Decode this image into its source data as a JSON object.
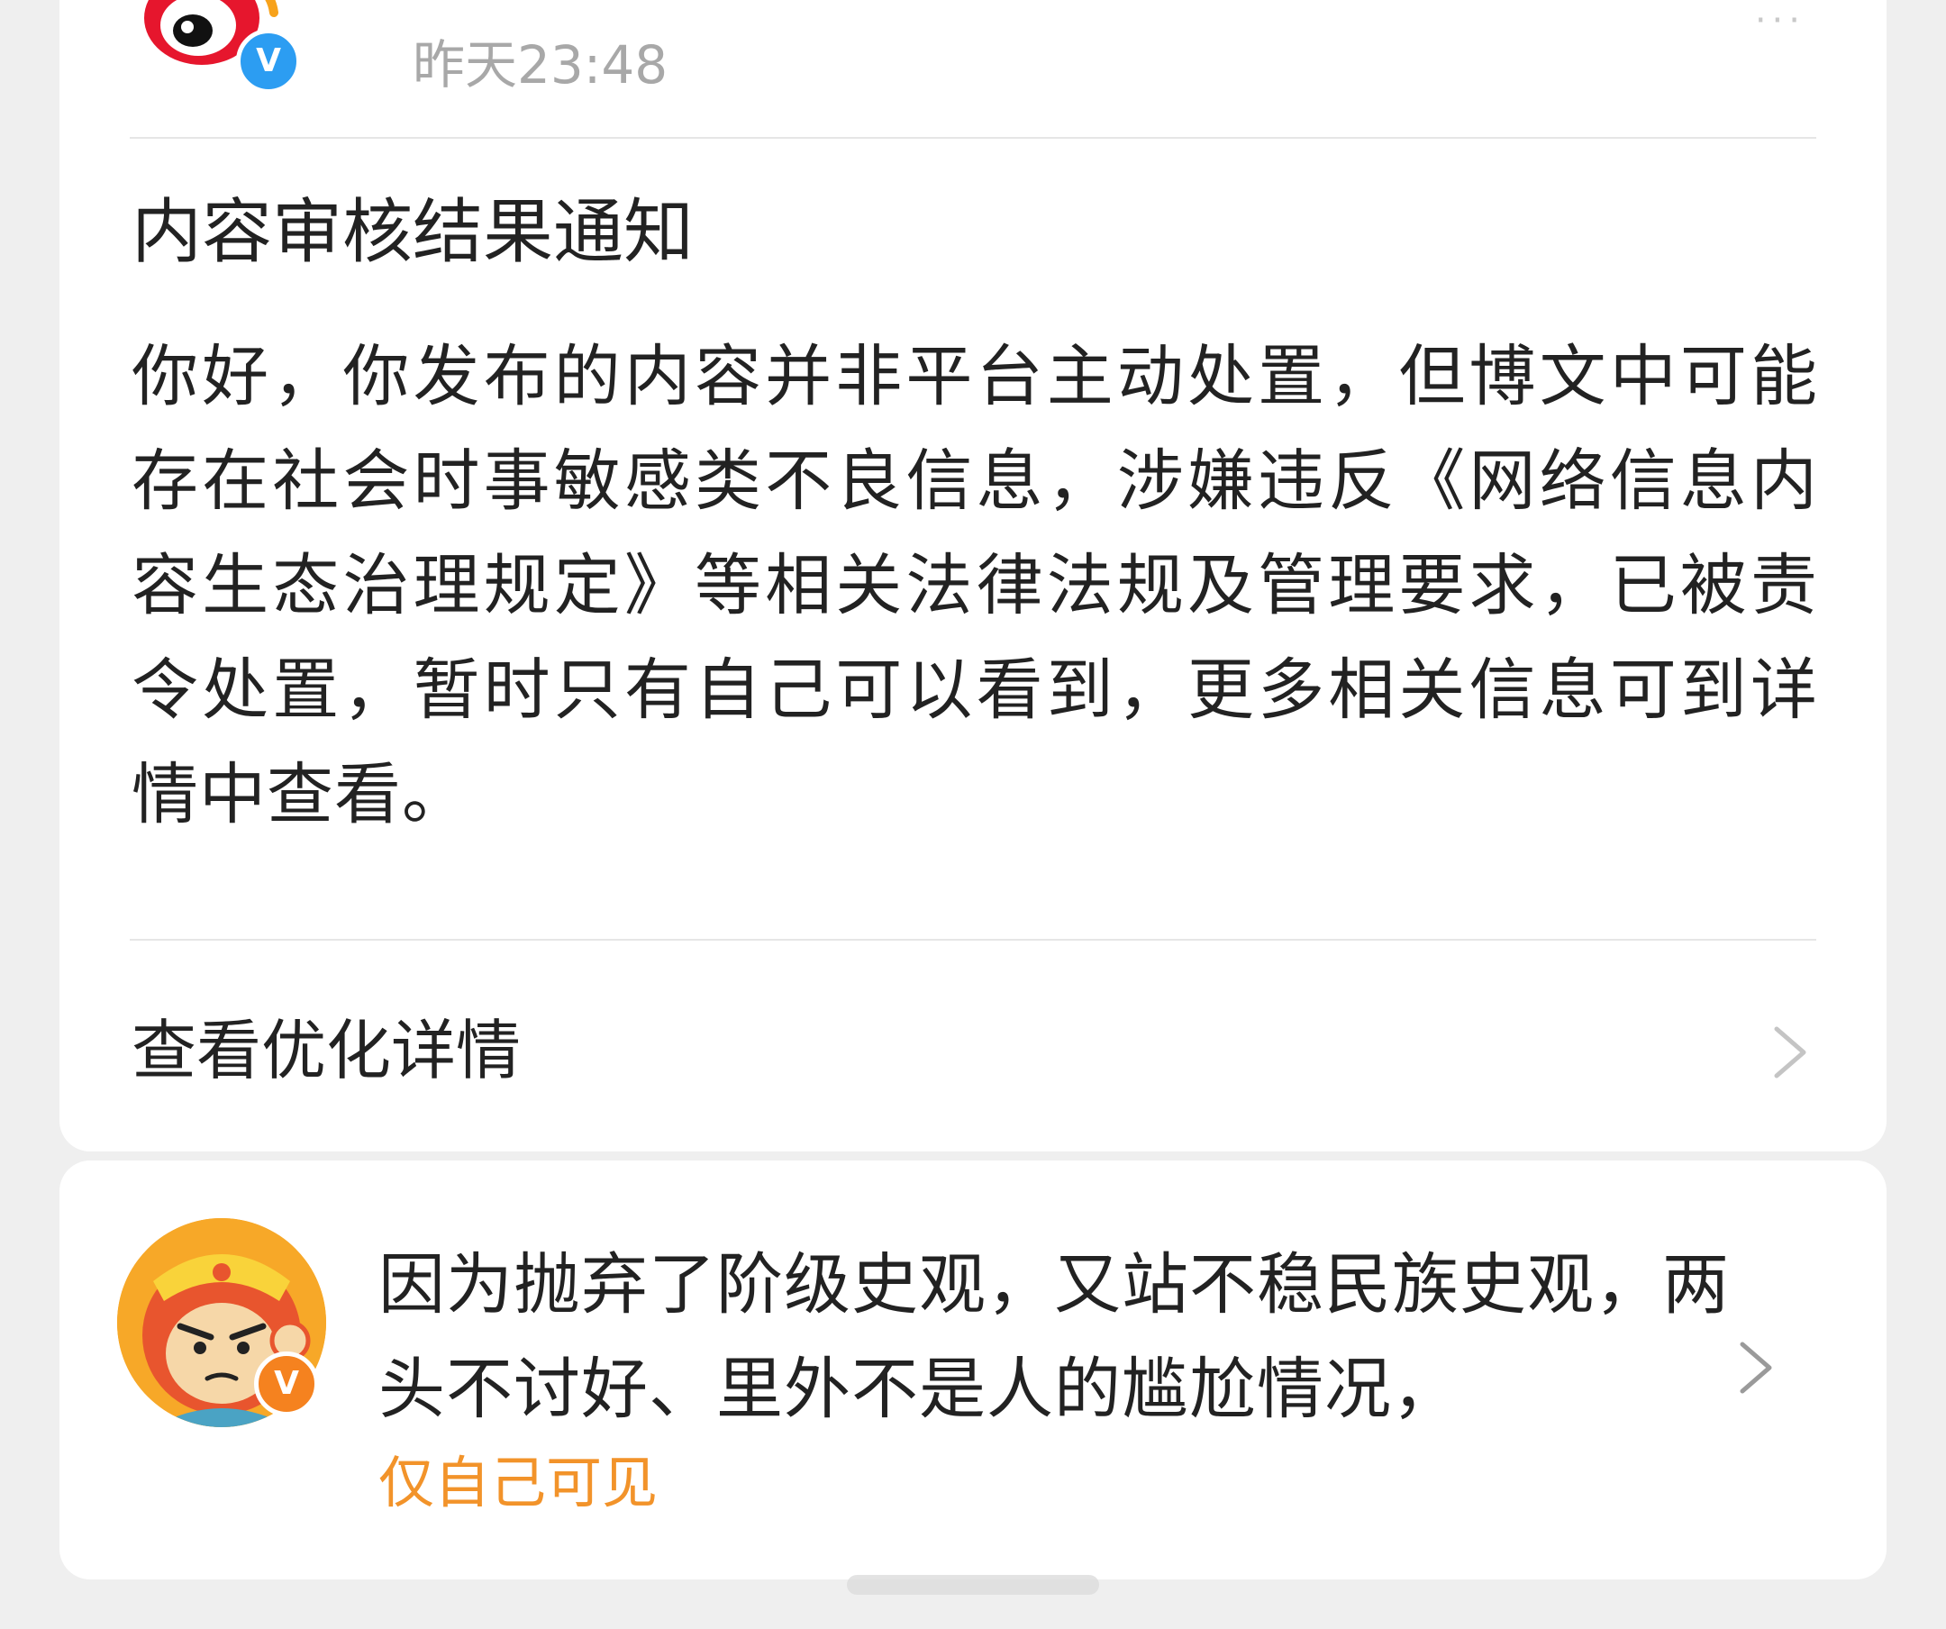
{
  "notice": {
    "sender_verified_badge": "V",
    "timestamp": "昨天23:48",
    "more_label": "···",
    "title": "内容审核结果通知",
    "body": "你好，你发布的内容并非平台主动处置，但博文中可能存在社会时事敏感类不良信息，涉嫌违反《网络信息内容生态治理规定》等相关法律法规及管理要求，已被责令处置，暂时只有自己可以看到，更多相关信息可到详情中查看。",
    "detail_link_label": "查看优化详情"
  },
  "post": {
    "author_verified_badge": "V",
    "text": "因为抛弃了阶级史观，又站不稳民族史观，两头不讨好、里外不是人的尴尬情况，",
    "visibility": "仅自己可见"
  },
  "colors": {
    "background": "#efefef",
    "card": "#ffffff",
    "timestamp": "#a8a8a8",
    "verified_blue": "#2c9df2",
    "verified_orange": "#f5821f",
    "visibility_tag": "#f2932a"
  },
  "icons": {
    "sender_avatar": "weibo-logo-icon",
    "chevron": "chevron-right-icon",
    "author_avatar": "monkey-king-avatar-icon"
  }
}
